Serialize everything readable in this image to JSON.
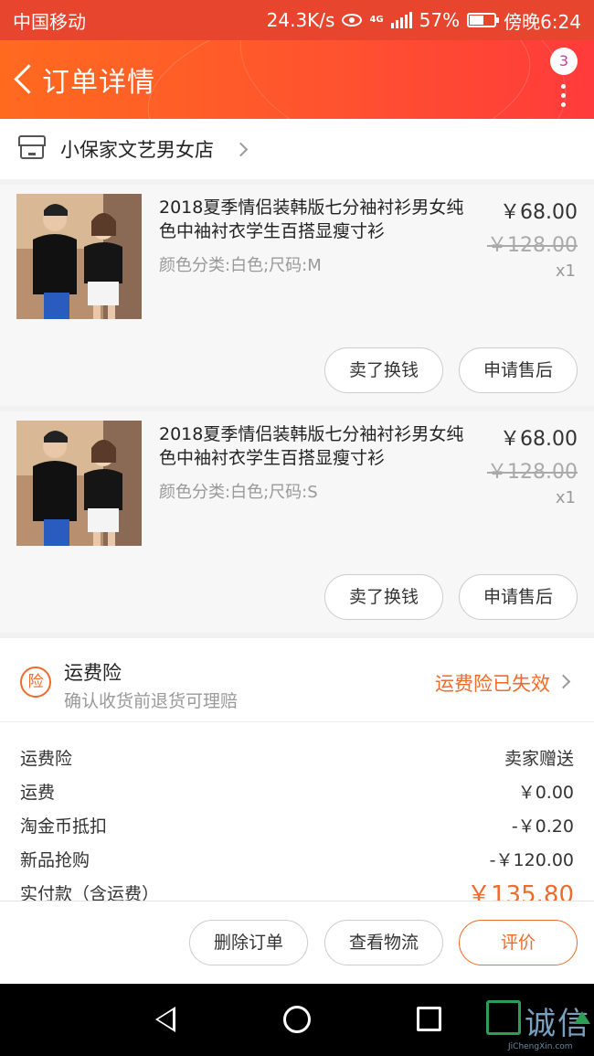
{
  "status_bar": {
    "carrier": "中国移动",
    "speed": "24.3K/s",
    "network": "4G",
    "battery": "57%",
    "time": "傍晚6:24"
  },
  "header": {
    "title": "订单详情",
    "badge_count": "3"
  },
  "shop": {
    "name": "小保家文艺男女店"
  },
  "items": [
    {
      "title": "2018夏季情侣装韩版七分袖衬衫男女纯色中袖衬衣学生百搭显瘦寸衫",
      "sku": "颜色分类:白色;尺码:M",
      "price": "￥68.00",
      "original_price": "￥128.00",
      "quantity": "x1",
      "sell_label": "卖了换钱",
      "after_sale_label": "申请售后"
    },
    {
      "title": "2018夏季情侣装韩版七分袖衬衫男女纯色中袖衬衣学生百搭显瘦寸衫",
      "sku": "颜色分类:白色;尺码:S",
      "price": "￥68.00",
      "original_price": "￥128.00",
      "quantity": "x1",
      "sell_label": "卖了换钱",
      "after_sale_label": "申请售后"
    }
  ],
  "insurance": {
    "icon_char": "险",
    "title": "运费险",
    "subtitle": "确认收货前退货可理赔",
    "status": "运费险已失效"
  },
  "fees": [
    {
      "label": "运费险",
      "value": "卖家赠送"
    },
    {
      "label": "运费",
      "value": "￥0.00"
    },
    {
      "label": "淘金币抵扣",
      "value": "-￥0.20"
    },
    {
      "label": "新品抢购",
      "value": "-￥120.00"
    },
    {
      "label": "实付款（含运费）",
      "value": "￥135.80"
    }
  ],
  "actions": {
    "delete_label": "删除订单",
    "logistics_label": "查看物流",
    "rate_label": "评价"
  },
  "watermark": {
    "text": "诚信",
    "sub": "JiChengXin.com"
  },
  "colors": {
    "accent": "#f06a2a",
    "header_start": "#ff6a1f",
    "header_end": "#ff3b3b",
    "badge_text": "#d03aa0"
  },
  "icons": [
    "back-arrow-icon",
    "more-vertical-icon",
    "shop-icon",
    "chevron-right-icon",
    "insurance-icon",
    "nav-back-icon",
    "nav-home-icon",
    "nav-recent-icon"
  ]
}
